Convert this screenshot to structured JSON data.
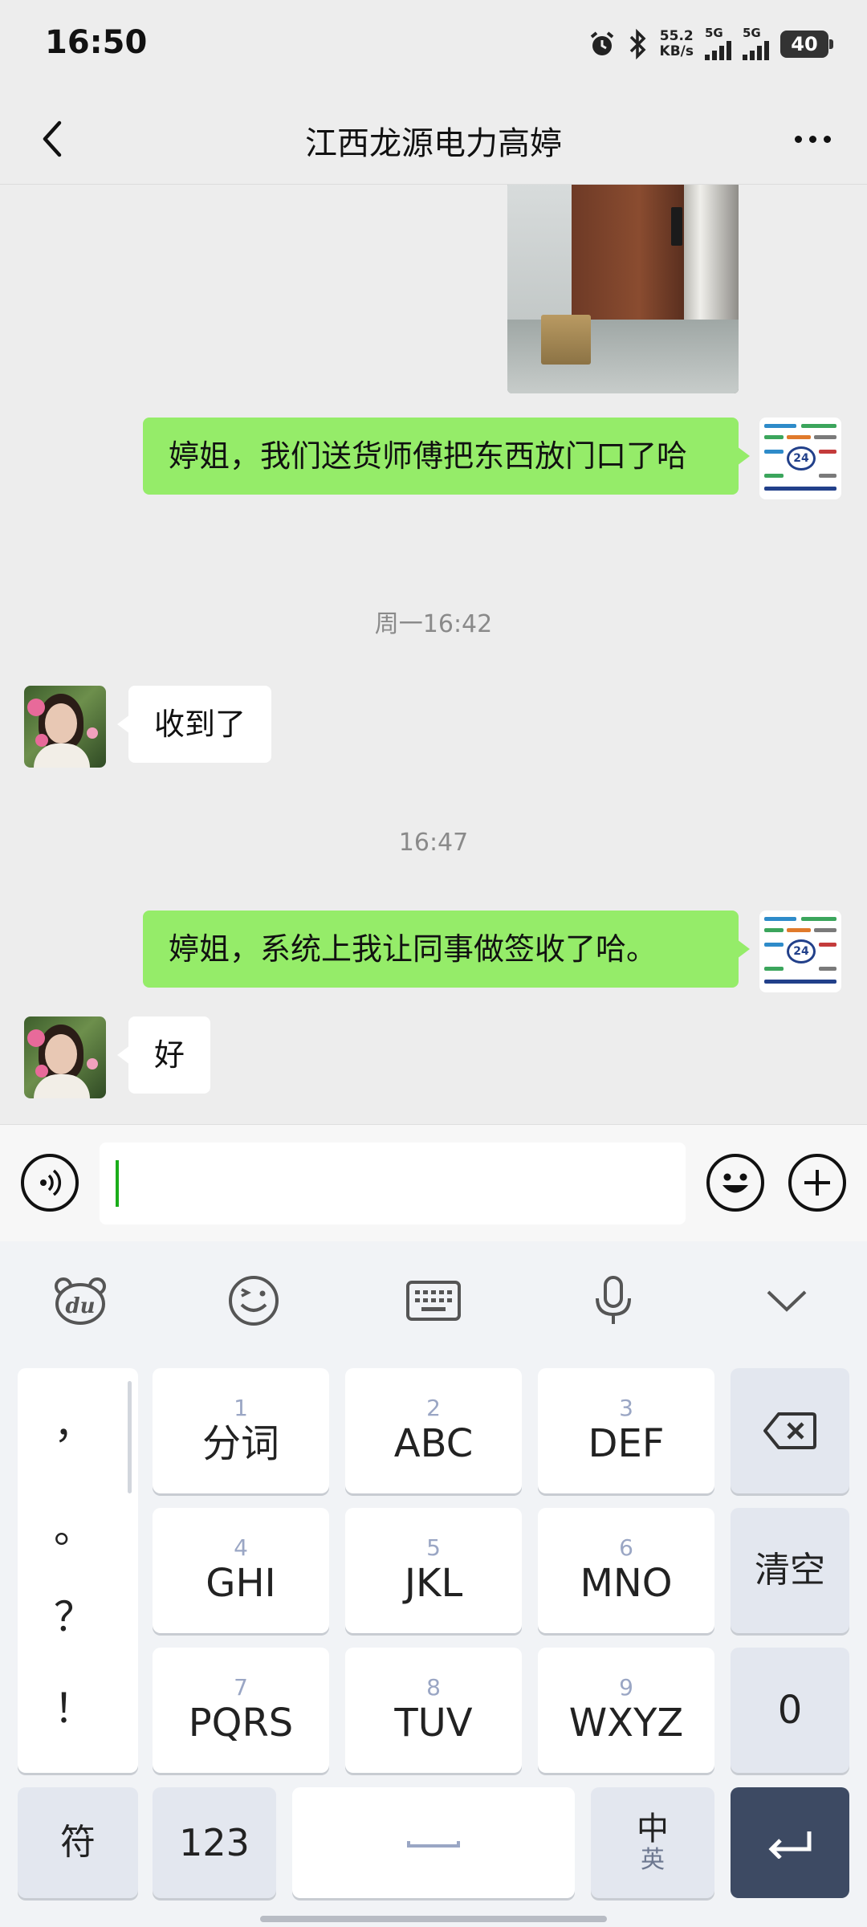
{
  "status_bar": {
    "time": "16:50",
    "net_speed": "55.2",
    "net_unit": "KB/s",
    "sim1_label": "5G",
    "sim2_label": "5G",
    "battery": "40"
  },
  "header": {
    "title": "江西龙源电力高婷"
  },
  "messages": [
    {
      "side": "out",
      "text": "婷姐，我们送货师傅把东西放门口了哈"
    },
    {
      "side": "in",
      "text": "收到了"
    },
    {
      "side": "out",
      "text": "婷姐，系统上我让同事做签收了哈。"
    },
    {
      "side": "in",
      "text": "好"
    }
  ],
  "timestamps": [
    "周一16:42",
    "16:47"
  ],
  "input": {
    "value": ""
  },
  "keyboard": {
    "punctuation": [
      "，",
      "。",
      "？",
      "！"
    ],
    "keys": [
      {
        "num": "1",
        "label": "分词"
      },
      {
        "num": "2",
        "label": "ABC"
      },
      {
        "num": "3",
        "label": "DEF"
      },
      {
        "num": "4",
        "label": "GHI"
      },
      {
        "num": "5",
        "label": "JKL"
      },
      {
        "num": "6",
        "label": "MNO"
      },
      {
        "num": "7",
        "label": "PQRS"
      },
      {
        "num": "8",
        "label": "TUV"
      },
      {
        "num": "9",
        "label": "WXYZ"
      }
    ],
    "clear_label": "清空",
    "zero_label": "0",
    "symbol_label": "符",
    "numeric_label": "123",
    "lang_primary": "中",
    "lang_secondary": "英"
  },
  "icons": {
    "back": "chevron-left-icon",
    "more": "more-dots-icon",
    "voice": "voice-icon",
    "emoji": "emoji-icon",
    "plus": "plus-icon",
    "baidu": "du-bear-icon",
    "kb_emoji": "smiley-icon",
    "keyboard": "keyboard-icon",
    "mic": "mic-icon",
    "collapse": "chevron-down-icon",
    "backspace": "backspace-icon",
    "enter": "enter-icon"
  },
  "colors": {
    "out_bubble": "#95ec69",
    "in_bubble": "#ffffff",
    "enter_key": "#3d4a63"
  }
}
